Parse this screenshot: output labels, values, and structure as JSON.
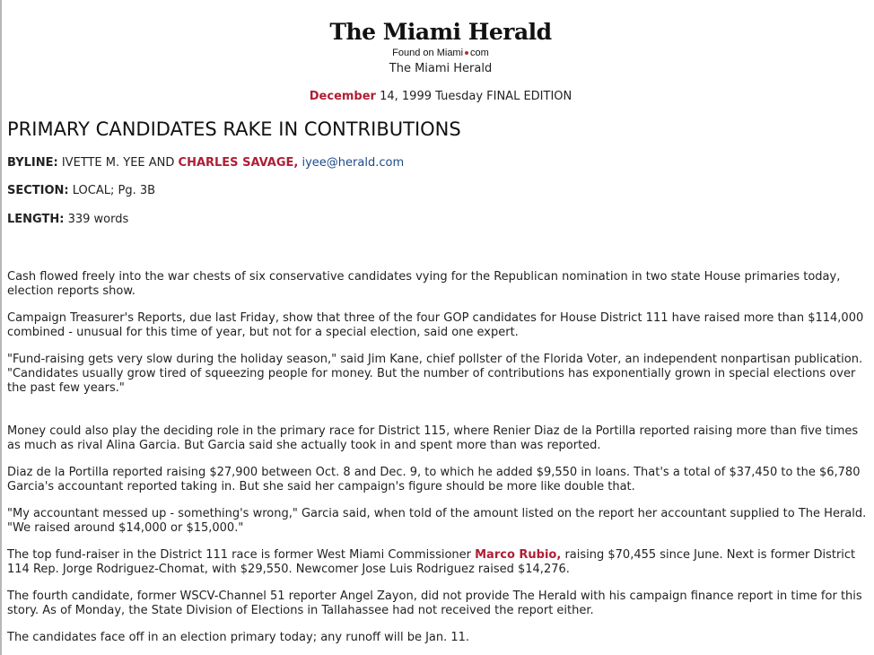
{
  "masthead": {
    "logo_text": "The Miami Herald",
    "found_on_prefix": "Found on Miami",
    "found_on_suffix": "com",
    "publication": "The Miami Herald"
  },
  "dateline": {
    "month": "December",
    "rest": " 14, 1999 Tuesday FINAL EDITION"
  },
  "headline": "PRIMARY CANDIDATES RAKE IN CONTRIBUTIONS",
  "byline": {
    "label": "BYLINE:",
    "authors_plain": " IVETTE M. YEE AND ",
    "author_highlight": "CHARLES SAVAGE,",
    "email": "iyee@herald.com"
  },
  "section": {
    "label": "SECTION:",
    "value": " LOCAL; Pg. 3B"
  },
  "length": {
    "label": "LENGTH:",
    "value": " 339 words"
  },
  "paragraphs": [
    "Cash flowed freely into the war chests of six conservative candidates vying for the Republican nomination in two state House primaries today, election reports show.",
    "Campaign Treasurer's Reports, due last Friday, show that three of the four GOP candidates for House District 111 have raised more than $114,000 combined - unusual for this time of year, but not for a special election, said one expert.",
    "\"Fund-raising gets very slow during the holiday season,\" said Jim Kane, chief pollster of the Florida Voter, an independent nonpartisan publication. \"Candidates usually grow tired of squeezing people for money. But the number of contributions has exponentially grown in special elections over the past few years.\"",
    "Money could also play the deciding role in the primary race for District 115, where Renier Diaz de la Portilla reported raising more than five times as much as rival Alina Garcia. But Garcia said she actually took in and spent more than was reported.",
    "Diaz de la Portilla reported raising $27,900 between Oct. 8 and Dec. 9, to which he added $9,550 in loans. That's a total of $37,450 to the $6,780 Garcia's accountant reported taking in. But she said her campaign's figure should be more like double that.",
    "\"My accountant messed up - something's wrong,\" Garcia said, when told of the amount listed on the report her accountant supplied to The Herald. \"We raised around $14,000 or $15,000.\""
  ],
  "paragraph_rubio": {
    "before": "The top fund-raiser in the District 111 race is former West Miami Commissioner ",
    "highlight": "Marco Rubio,",
    "after": " raising $70,455 since June. Next is former District 114 Rep. Jorge Rodriguez-Chomat, with $29,550. Newcomer Jose Luis Rodriguez raised $14,276."
  },
  "paragraphs_end": [
    "The fourth candidate, former WSCV-Channel 51 reporter Angel Zayon, did not provide The Herald with his campaign finance report in time for this story. As of Monday, the State Division of Elections in Tallahassee had not received the report either.",
    "The candidates face off in an election primary today; any runoff will be Jan. 11."
  ],
  "colors": {
    "highlight": "#b01e35",
    "link": "#1c4a8a",
    "logo_dot": "#c0262e"
  }
}
